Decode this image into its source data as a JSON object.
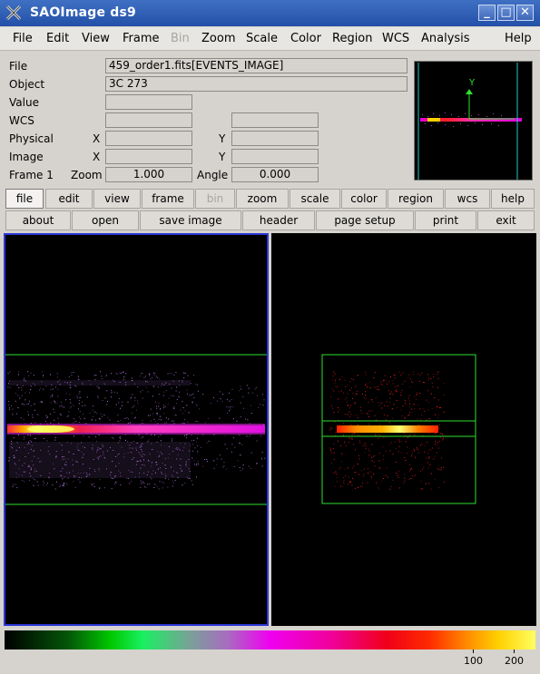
{
  "window": {
    "title": "SAOImage ds9"
  },
  "menu": [
    "File",
    "Edit",
    "View",
    "Frame",
    "Bin",
    "Zoom",
    "Scale",
    "Color",
    "Region",
    "WCS",
    "Analysis",
    "Help"
  ],
  "info": {
    "file_label": "File",
    "file_value": "459_order1.fits[EVENTS_IMAGE]",
    "object_label": "Object",
    "object_value": "3C 273",
    "value_label": "Value",
    "wcs_label": "WCS",
    "physical_label": "Physical",
    "image_label": "Image",
    "frame_label": "Frame 1",
    "x_label": "X",
    "y_label": "Y",
    "zoom_label": "Zoom",
    "zoom_value": "1.000",
    "angle_label": "Angle",
    "angle_value": "0.000"
  },
  "panner": {
    "axis_label": "Y"
  },
  "buttons_row1": [
    "file",
    "edit",
    "view",
    "frame",
    "bin",
    "zoom",
    "scale",
    "color",
    "region",
    "wcs",
    "help"
  ],
  "buttons_row2": [
    "about",
    "open",
    "save image",
    "header",
    "page setup",
    "print",
    "exit"
  ],
  "colorbar": {
    "ticks": [
      "100",
      "200"
    ]
  },
  "colors": {
    "title_bar": "#2c5bb4",
    "frame_highlight": "#2c38d8",
    "region": "#2ee02e",
    "panner_box": "#26c6c6"
  }
}
